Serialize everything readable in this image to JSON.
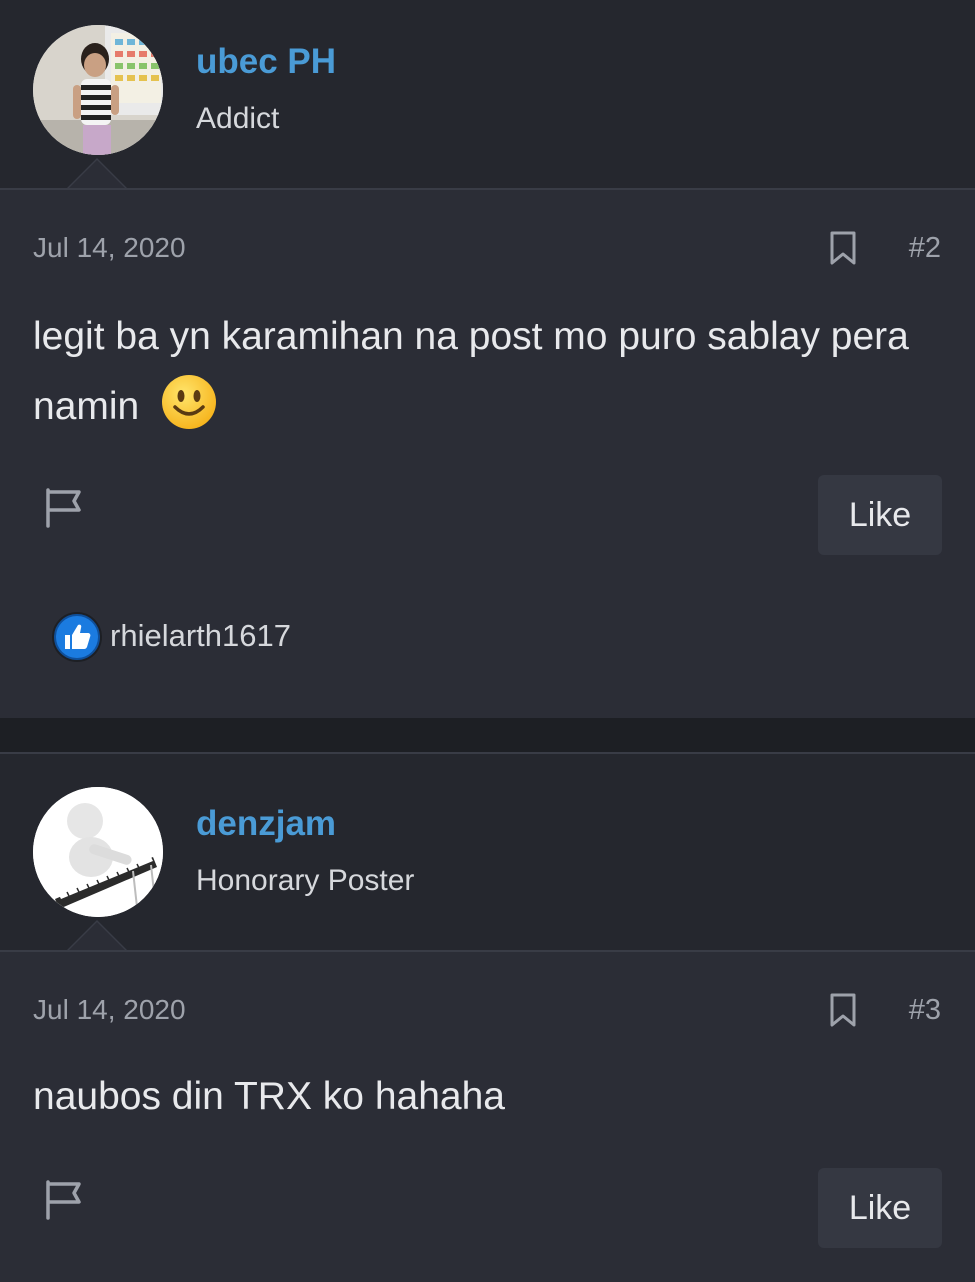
{
  "posts": [
    {
      "username": "ubec PH",
      "user_title": "Addict",
      "date": "Jul 14, 2020",
      "post_number": "#2",
      "text": "legit ba yn karamihan na post mo puro sablay pera namin",
      "emoji": "🙂",
      "like_label": "Like",
      "reaction_user": "rhielarth1617"
    },
    {
      "username": "denzjam",
      "user_title": "Honorary Poster",
      "date": "Jul 14, 2020",
      "post_number": "#3",
      "text": "naubos din TRX ko hahaha",
      "like_label": "Like"
    }
  ],
  "icons": {
    "bookmark": "bookmark-icon",
    "flag": "flag-icon",
    "reaction": "thumbs-up-icon"
  },
  "colors": {
    "username": "#4a9bd6",
    "background": "#1d1f24",
    "header": "#25272e",
    "body": "#2b2d36"
  }
}
